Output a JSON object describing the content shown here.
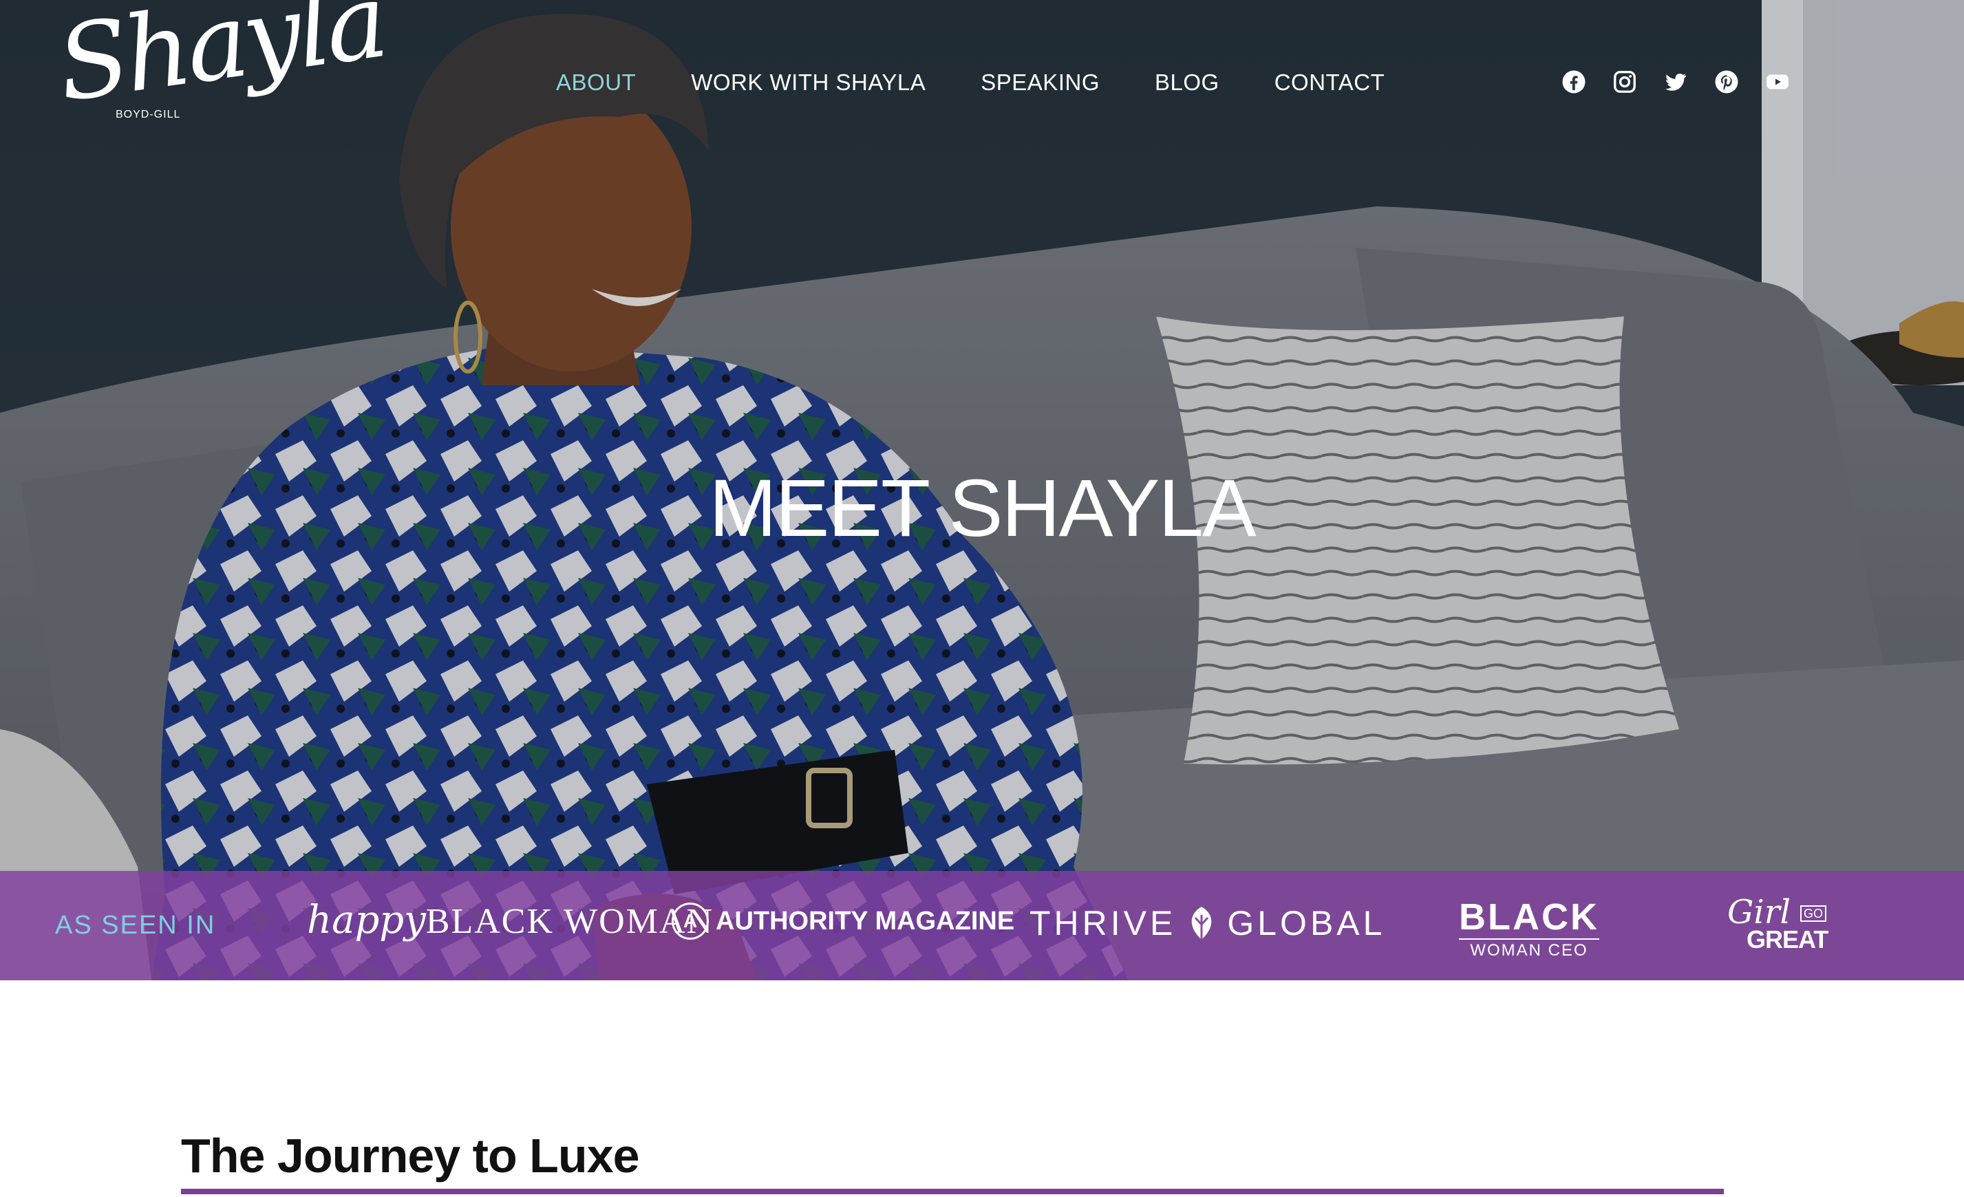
{
  "brand": {
    "logo_script": "Shayla",
    "logo_sub": "BOYD-GILL"
  },
  "nav": {
    "items": [
      {
        "label": "ABOUT",
        "active": true
      },
      {
        "label": "WORK WITH SHAYLA",
        "active": false
      },
      {
        "label": "SPEAKING",
        "active": false
      },
      {
        "label": "BLOG",
        "active": false
      },
      {
        "label": "CONTACT",
        "active": false
      }
    ]
  },
  "social": [
    "facebook-icon",
    "instagram-icon",
    "twitter-icon",
    "pinterest-icon",
    "youtube-icon"
  ],
  "hero": {
    "title": "MEET SHAYLA"
  },
  "press": {
    "label": "AS SEEN IN",
    "logos": {
      "hbw_happy": "happy",
      "hbw_rest": "BLACK WOMAN",
      "authority": "AUTHORITY MAGAZINE",
      "authority_mark": "A",
      "thrive_left": "THRIVE",
      "thrive_right": "GLOBAL",
      "bwc_big": "BLACK",
      "bwc_small": "WOMAN CEO",
      "girl": "Girl",
      "go": "GO",
      "great": "GREAT"
    }
  },
  "content": {
    "heading": "The Journey to Luxe"
  },
  "colors": {
    "accent_purple": "#7b3f98",
    "nav_active": "#8fd3dd",
    "press_label": "#7fcfe0"
  }
}
